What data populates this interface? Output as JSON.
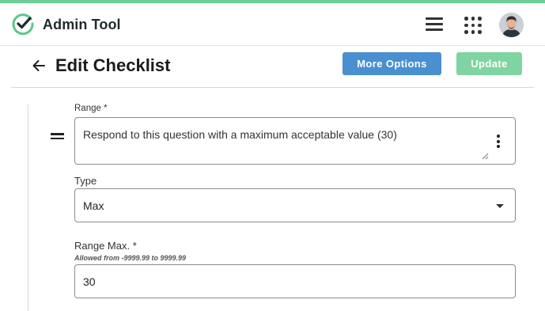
{
  "app": {
    "title": "Admin Tool",
    "accent_color": "#6ccf95",
    "icons": {
      "logo": "check-circle-logo",
      "menu": "hamburger-icon",
      "apps": "grid-dots-icon",
      "avatar": "user-avatar"
    }
  },
  "page": {
    "back_icon": "arrow-left-icon",
    "title": "Edit Checklist",
    "more_options_label": "More Options",
    "update_label": "Update",
    "colors": {
      "more_options": "#4a8fcf",
      "update": "#7fd4a2"
    }
  },
  "form": {
    "drag_icon": "drag-handle-icon",
    "range_label": "Range *",
    "range_value": "Respond to this question with a maximum acceptable value (30)",
    "options_icon": "kebab-menu-icon",
    "type_label": "Type",
    "type_value": "Max",
    "range_max_label": "Range Max. *",
    "range_max_hint": "Allowed from -9999.99 to 9999.99",
    "range_max_value": "30"
  }
}
